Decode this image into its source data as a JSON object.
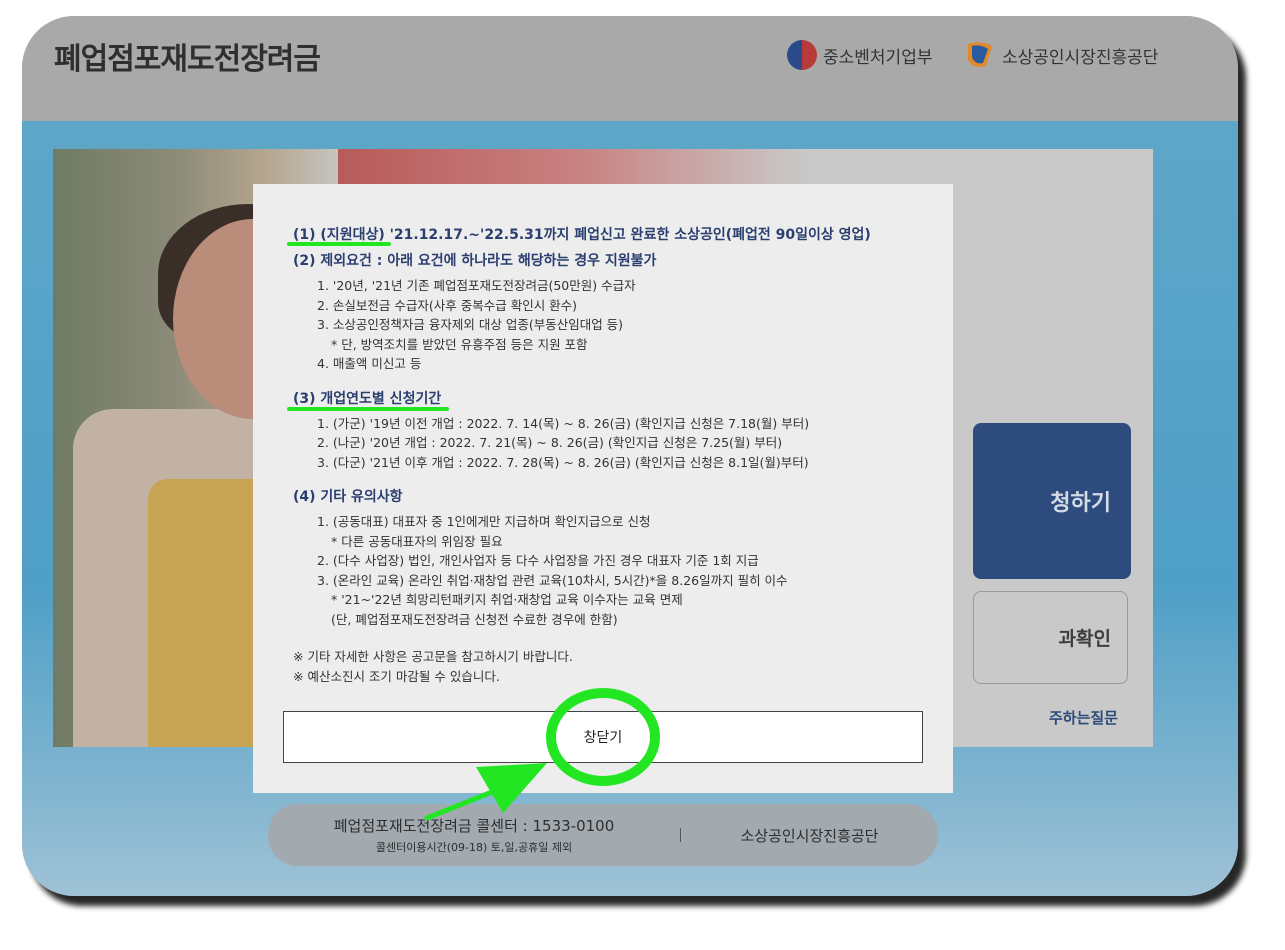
{
  "header": {
    "site_title": "폐업점포재도전장려금",
    "logo_mss": "중소벤처기업부",
    "logo_semas": "소상공인시장진흥공단"
  },
  "main": {
    "apply_button": "청하기",
    "result_button": "과확인",
    "faq_link": "주하는질문"
  },
  "footer": {
    "call_center": "폐업점포재도전장려금 콜센터 : 1533-0100",
    "call_hours": "콜센터이용시간(09-18) 토,일,공휴일 제외",
    "org": "소상공인시장진흥공단"
  },
  "modal": {
    "sec1_label": "(1) (지원대상)",
    "sec1_text": " '21.12.17.~'22.5.31까지 폐업신고 완료한 소상공인(폐업전 90일이상 영업)",
    "sec2_title": "(2) 제외요건 : 아래 요건에 하나라도 해당하는 경우 지원불가",
    "sec2_items": [
      "1. '20년, '21년 기존 폐업점포재도전장려금(50만원) 수급자",
      "2. 손실보전금 수급자(사후 중복수급 확인시 환수)",
      "3. 소상공인정책자금 융자제외 대상 업종(부동산임대업 등)",
      "* 단, 방역조치를 받았던 유흥주점 등은 지원 포함",
      "4. 매출액 미신고 등"
    ],
    "sec3_title": "(3) 개업연도별 신청기간",
    "sec3_items": [
      "1. (가군) '19년 이전 개업 : 2022. 7. 14(목) ~ 8. 26(금) (확인지급 신청은 7.18(월) 부터)",
      "2. (나군) '20년 개업 : 2022. 7. 21(목) ~ 8. 26(금) (확인지급 신청은 7.25(월) 부터)",
      "3. (다군) '21년 이후 개업 : 2022. 7. 28(목) ~ 8. 26(금) (확인지급 신청은 8.1일(월)부터)"
    ],
    "sec4_title": "(4) 기타 유의사항",
    "sec4_items": [
      "1. (공동대표) 대표자 중 1인에게만 지급하며 확인지급으로 신청",
      "* 다른 공동대표자의 위임장 필요",
      "2. (다수 사업장) 법인, 개인사업자 등 다수 사업장을 가진 경우 대표자 기준 1회 지급",
      "3. (온라인 교육) 온라인 취업·재창업 관련 교육(10차시, 5시간)*을 8.26일까지 필히 이수",
      "* '21~'22년 희망리턴패키지 취업·재창업 교육 이수자는 교육 면제",
      "(단, 폐업점포재도전장려금 신청전 수료한 경우에 한함)"
    ],
    "note1": "※ 기타 자세한 사항은 공고문을 참고하시기 바랍니다.",
    "note2": "※ 예산소진시 조기 마감될 수 있습니다.",
    "close_label": "창닫기"
  },
  "colors": {
    "annotation": "#22e622",
    "primary_button": "#2e4b7d",
    "heading_blue": "#2a3f70"
  }
}
